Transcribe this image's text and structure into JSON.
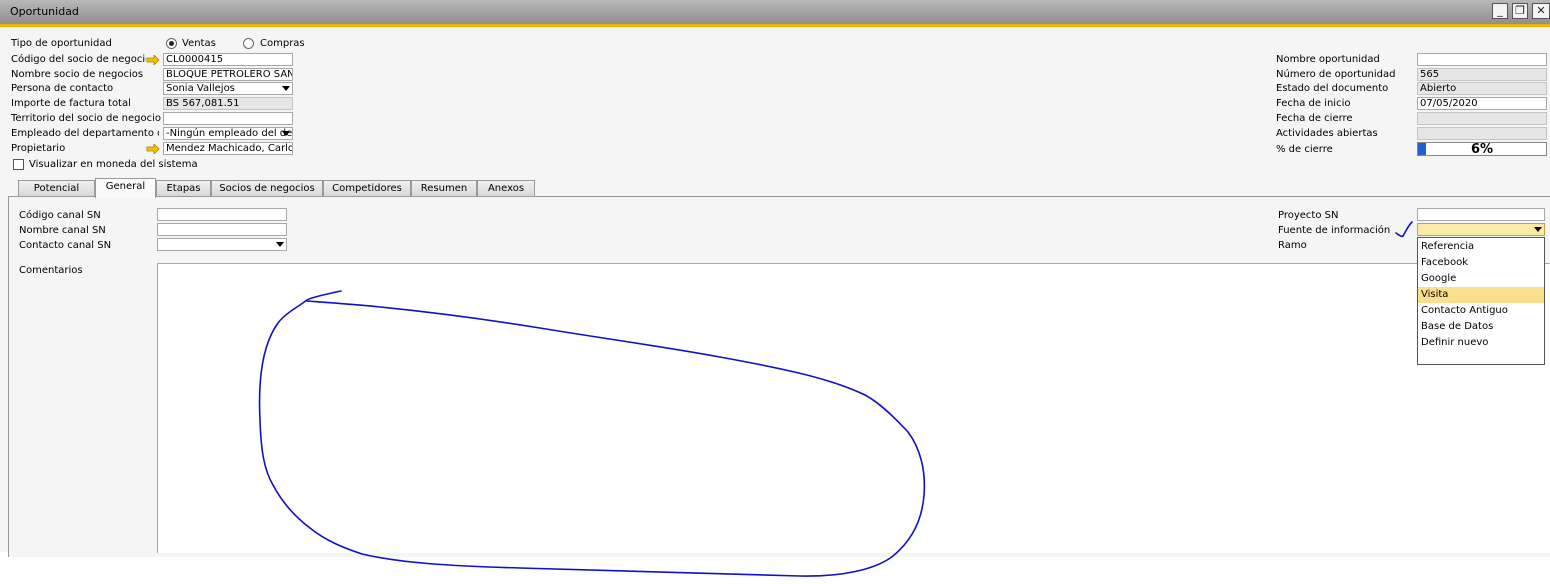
{
  "window": {
    "title": "Oportunidad"
  },
  "header": {
    "tipo_label": "Tipo de oportunidad",
    "radio_ventas": "Ventas",
    "radio_compras": "Compras",
    "codigo_label": "Código del socio de negocios",
    "codigo_value": "CL0000415",
    "nombre_label": "Nombre socio de negocios",
    "nombre_value": "BLOQUE PETROLERO SAN",
    "persona_label": "Persona de contacto",
    "persona_value": "Sonia Vallejos",
    "importe_label": "Importe de factura total",
    "importe_value": "BS 567,081.51",
    "territorio_label": "Territorio del socio de negocios",
    "territorio_value": "",
    "empleado_label": "Empleado del departamento de ventas",
    "empleado_value": "-Ningún empleado del departamento",
    "propietario_label": "Propietario",
    "propietario_value": "Mendez Machicado, Carlos",
    "visualizar_label": "Visualizar en moneda del sistema"
  },
  "right": {
    "nombre_op_label": "Nombre oportunidad",
    "nombre_op_value": "",
    "numero_label": "Número de oportunidad",
    "numero_value": "565",
    "estado_label": "Estado del documento",
    "estado_value": "Abierto",
    "fecha_inicio_label": "Fecha de inicio",
    "fecha_inicio_value": "07/05/2020",
    "fecha_cierre_label": "Fecha de cierre",
    "fecha_cierre_value": "",
    "actividades_label": "Actividades abiertas",
    "actividades_value": "",
    "cierre_label": "% de cierre",
    "cierre_value": "6%",
    "cierre_fraction": 0.06
  },
  "tabs": [
    "Potencial",
    "General",
    "Etapas",
    "Socios de negocios",
    "Competidores",
    "Resumen",
    "Anexos"
  ],
  "general": {
    "canal_codigo_label": "Código canal SN",
    "canal_codigo_value": "",
    "canal_nombre_label": "Nombre canal SN",
    "canal_nombre_value": "",
    "canal_contacto_label": "Contacto canal SN",
    "canal_contacto_value": "",
    "comentarios_label": "Comentarios",
    "comentarios_value": "",
    "proyecto_label": "Proyecto SN",
    "proyecto_value": "",
    "fuente_label": "Fuente de información",
    "fuente_value": "",
    "ramo_label": "Ramo"
  },
  "fuente_options": [
    "Referencia",
    "Facebook",
    "Google",
    "Visita",
    "Contacto Antiguo",
    "Base de Datos",
    "Definir nuevo"
  ],
  "fuente_highlighted": "Visita",
  "colors": {
    "accent": "#f0b400",
    "arrow": "#e8b800",
    "annotation": "#1010c8",
    "highlight": "#fadf8c"
  }
}
